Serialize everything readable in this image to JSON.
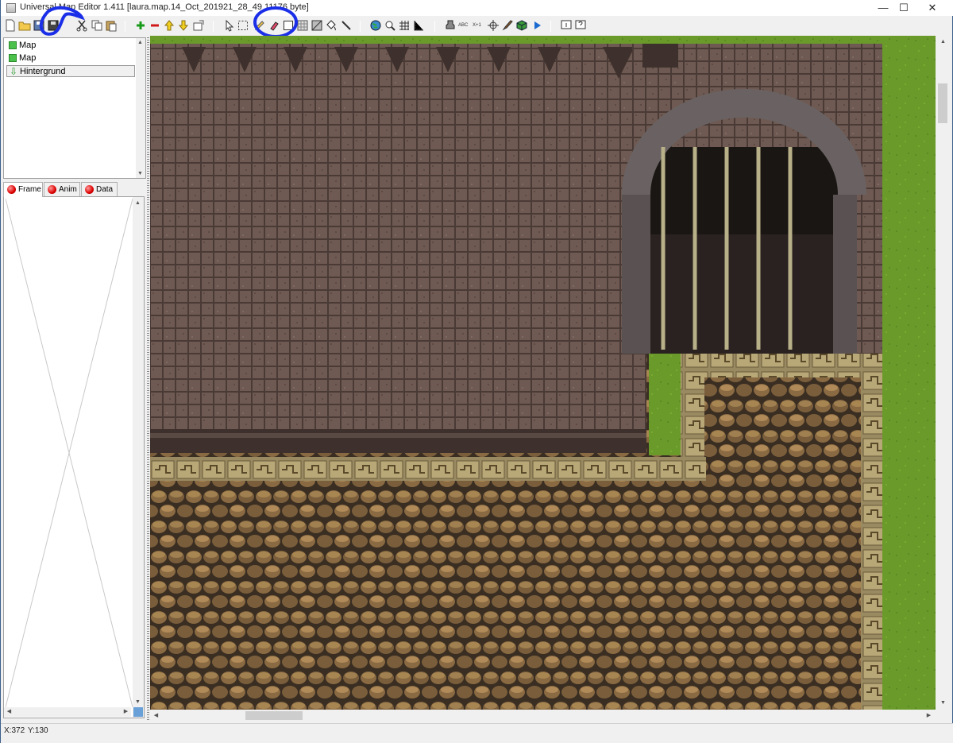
{
  "window": {
    "title": "Universal Map Editor 1.411  [laura.map.14_Oct_201921_28_49  11176 byte]",
    "minimize_label": "—",
    "maximize_label": "☐",
    "close_label": "✕"
  },
  "layers": {
    "items": [
      {
        "label": "Map"
      },
      {
        "label": "Map"
      },
      {
        "label": "Hintergrund"
      }
    ]
  },
  "tabs": [
    {
      "label": "Frame"
    },
    {
      "label": "Anim"
    },
    {
      "label": "Data"
    }
  ],
  "status": {
    "x": "X:372",
    "y": "Y:130"
  },
  "toolbar": {
    "abc_label": "ABC",
    "x1_label": "X+1"
  },
  "colors": {
    "annotation": "#1b2ee8",
    "grass": "#6a9a2a",
    "brick": "#6e5a52",
    "mortar": "#4a3a36",
    "cobble": "#8a6a42"
  }
}
